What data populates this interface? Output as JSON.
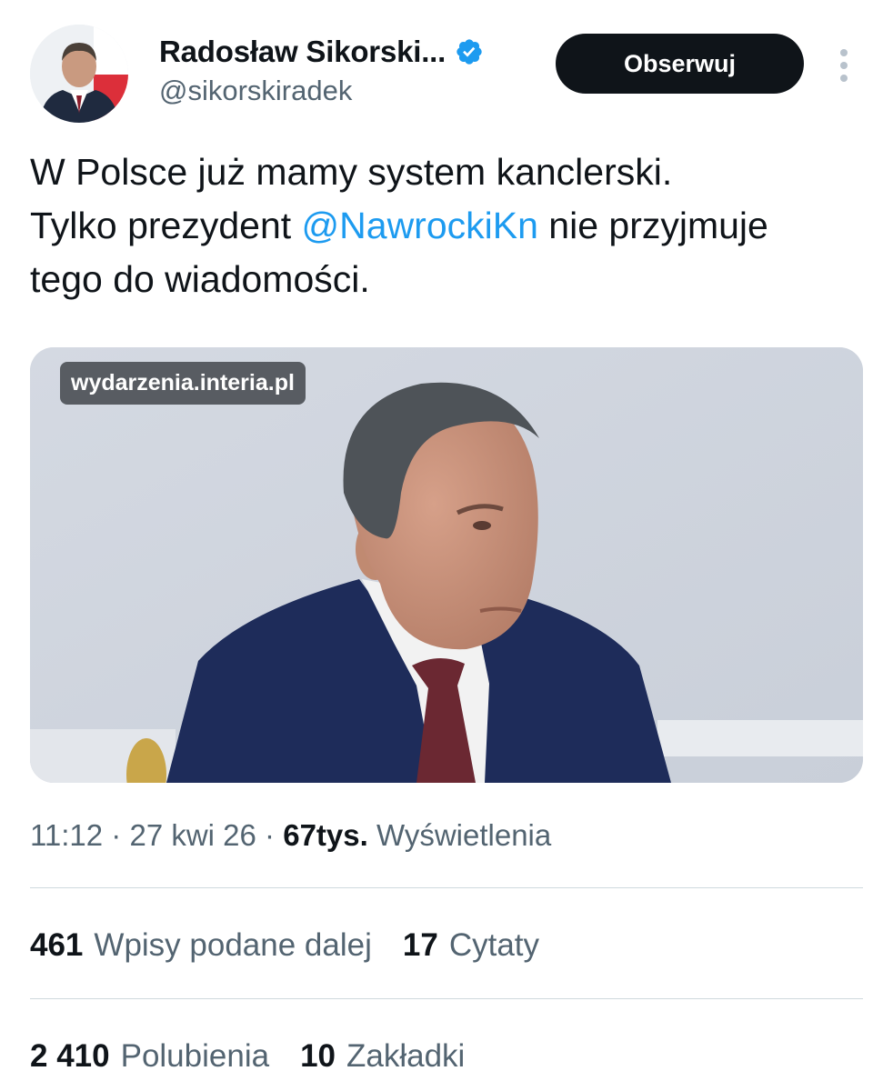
{
  "author": {
    "display_name": "Radosław Sikorski...",
    "handle": "@sikorskiradek",
    "verified": true,
    "verified_color": "#1d9bf0"
  },
  "header": {
    "follow_label": "Obserwuj",
    "more_icon": "more-vertical-icon"
  },
  "tweet": {
    "text_line1": "W Polsce już mamy system kanclerski.",
    "text_line2_before": "Tylko prezydent ",
    "mention": "@NawrockiKn",
    "text_line2_after": " nie przyjmuje",
    "text_line3": "tego do wiadomości."
  },
  "media": {
    "link_badge": "wydarzenia.interia.pl"
  },
  "meta": {
    "time": "11:12",
    "separator1": " · ",
    "date": "27 kwi 26",
    "separator2": " · ",
    "views_count": "67tys.",
    "views_label": " Wyświetlenia"
  },
  "stats_row1": [
    {
      "count": "461",
      "label": "Wpisy podane dalej"
    },
    {
      "count": "17",
      "label": "Cytaty"
    }
  ],
  "stats_row2": [
    {
      "count": "2 410",
      "label": "Polubienia"
    },
    {
      "count": "10",
      "label": "Zakładki"
    }
  ],
  "colors": {
    "text": "#0f1419",
    "secondary": "#536471",
    "accent": "#1d9bf0",
    "button_bg": "#0f1419"
  }
}
